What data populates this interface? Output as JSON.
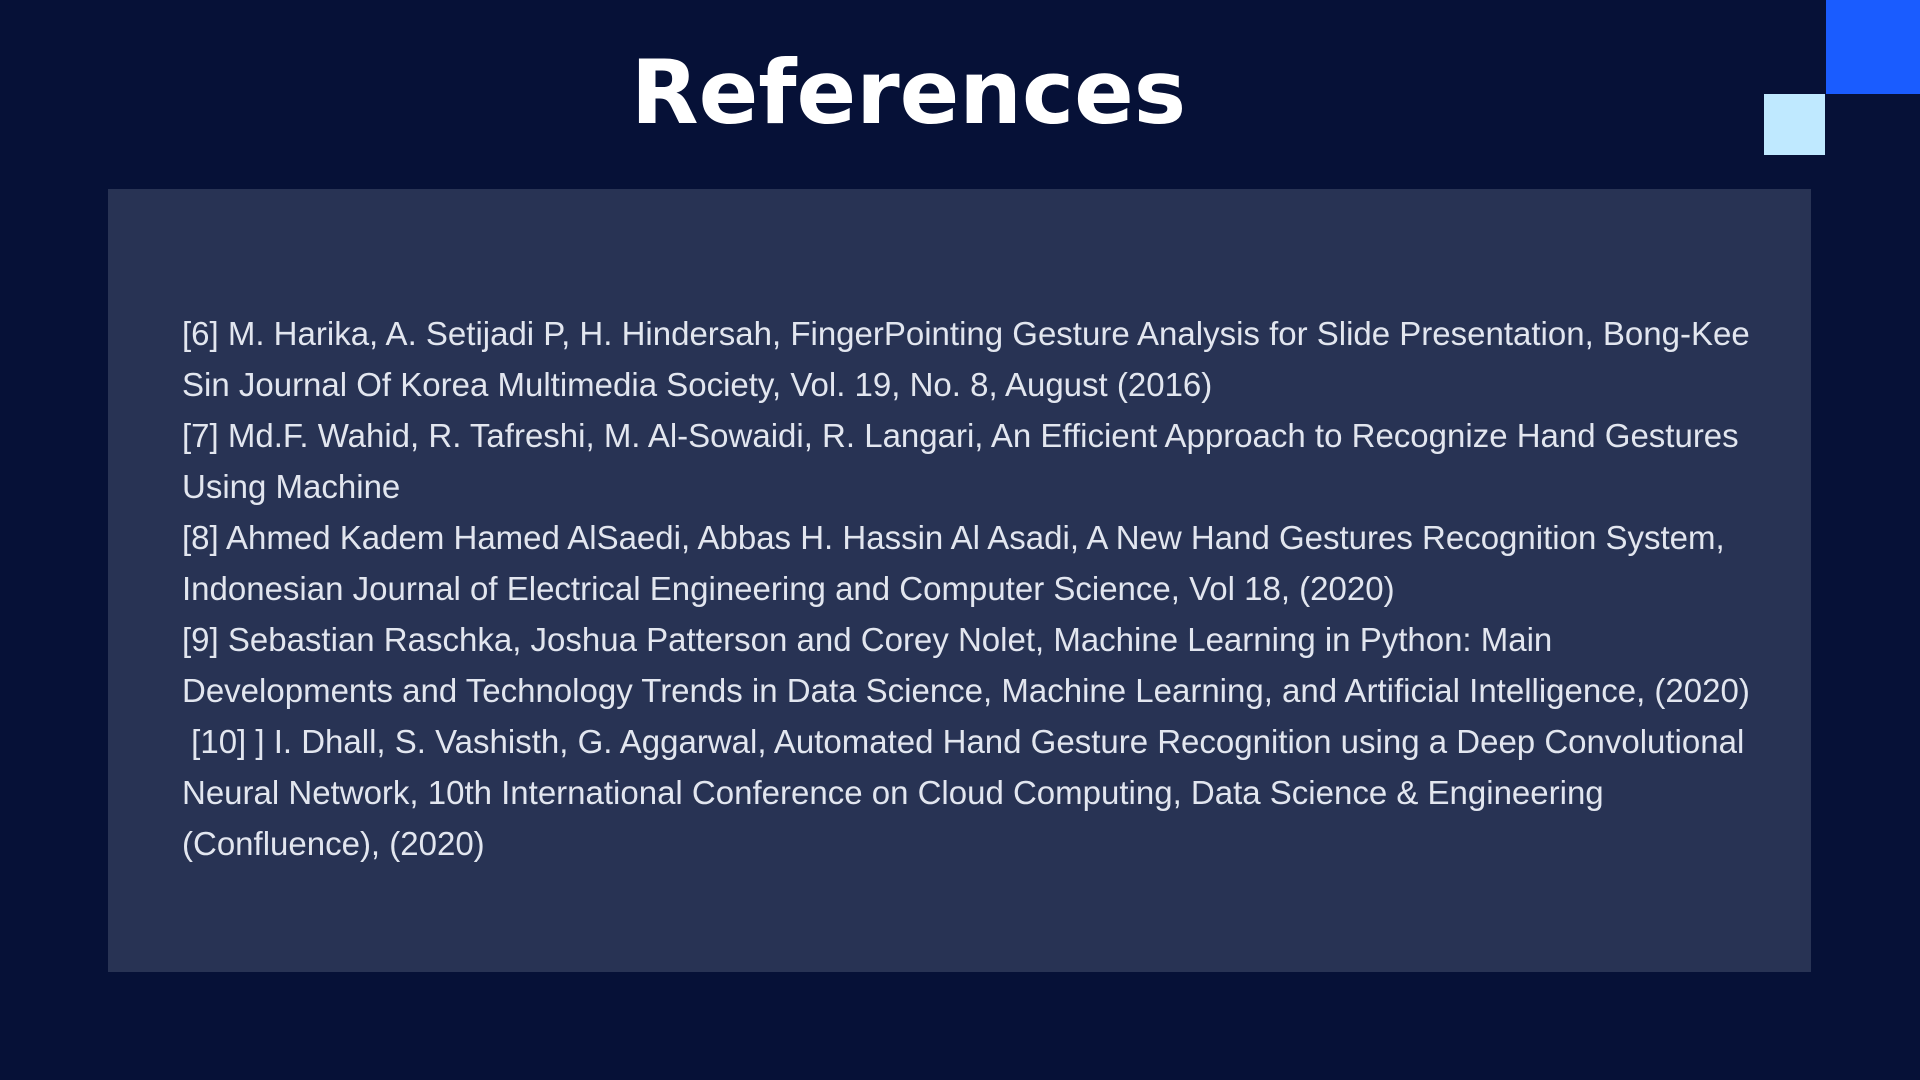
{
  "slide": {
    "title": "References",
    "colors": {
      "background": "#061137",
      "panel": "#283354",
      "accent_blue": "#1a5cff",
      "accent_light": "#bfe9ff",
      "title_text": "#ffffff",
      "body_text": "#e2e6ef"
    }
  },
  "references": [
    "[6] M. Harika, A. Setijadi P, H. Hindersah, FingerPointing Gesture Analysis for Slide Presentation, Bong-Kee Sin Journal Of Korea Multimedia Society, Vol. 19, No. 8, August (2016)",
    "[7] Md.F. Wahid, R. Tafreshi, M. Al-Sowaidi, R. Langari, An Efficient Approach to Recognize Hand Gestures Using Machine",
    "[8] Ahmed Kadem Hamed AlSaedi, Abbas H. Hassin Al Asadi, A New Hand Gestures Recognition System, Indonesian Journal of Electrical Engineering and Computer Science, Vol 18, (2020)",
    "[9] Sebastian Raschka, Joshua Patterson and Corey Nolet, Machine Learning in Python: Main Developments and Technology Trends in Data Science, Machine Learning, and Artificial Intelligence, (2020)",
    " [10] ] I. Dhall, S. Vashisth, G. Aggarwal, Automated Hand Gesture Recognition using a Deep Convolutional Neural Network, 10th International Conference on Cloud Computing, Data Science & Engineering (Confluence), (2020)"
  ]
}
